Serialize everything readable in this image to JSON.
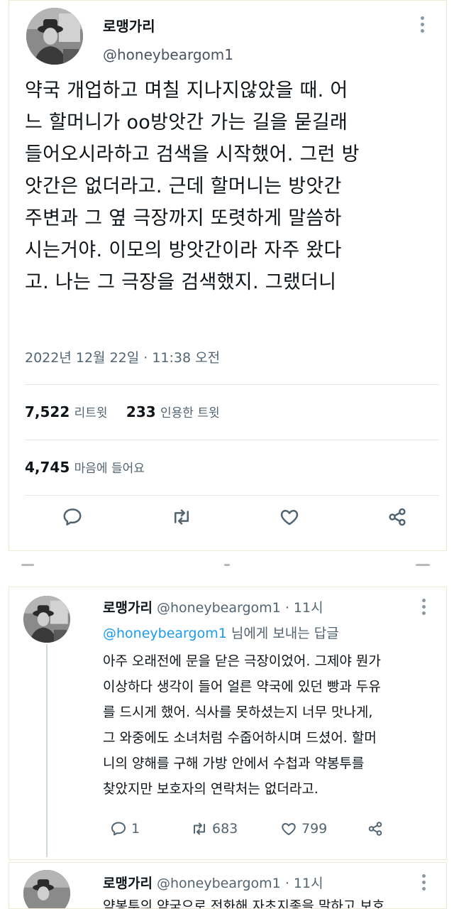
{
  "main_tweet": {
    "display_name": "로맹가리",
    "handle": "@honeybeargom1",
    "body_lines": [
      "약국 개업하고 며칠 지나지않았을 때. 어",
      "느 할머니가 oo방앗간 가는 길을 묻길래",
      "들어오시라하고 검색을 시작했어. 그런 방",
      "앗간은 없더라고. 근데 할머니는 방앗간",
      "주변과 그 옆 극장까지 또렷하게 말씀하",
      "시는거야. 이모의 방앗간이라 자주 왔다",
      "고. 나는 그 극장을 검색했지. 그랬더니"
    ],
    "timestamp": "2022년 12월 22일 · 11:38 오전",
    "retweets_count": "7,522",
    "retweets_label": "리트윗",
    "quotes_count": "233",
    "quotes_label": "인용한 트윗",
    "likes_count": "4,745",
    "likes_label": "마음에 들어요"
  },
  "reply_tweet": {
    "display_name": "로맹가리",
    "handle": "@honeybeargom1",
    "time": "· 11시",
    "reply_to_user": "@honeybeargom1",
    "reply_to_text": "님에게 보내는 답글",
    "body_lines": [
      "아주 오래전에 문을 닫은 극장이었어. 그제야 뭔가",
      "이상하다 생각이 들어 얼른 약국에 있던 빵과 두유",
      "를 드시게 했어. 식사를 못하셨는지 너무 맛나게,",
      "그 와중에도 소녀처럼 수줍어하시며 드셨어. 할머",
      "니의 양해를 구해 가방 안에서 수첩과 약봉투를",
      "찾았지만 보호자의 연락처는 없더라고."
    ],
    "reply_count": "1",
    "retweet_count": "683",
    "like_count": "799"
  },
  "third_tweet": {
    "display_name": "로맹가리",
    "handle": "@honeybeargom1",
    "time": "· 11시",
    "body_partial": "약봉투의 약국으로 전화해 자초지종을 말하고 보호"
  },
  "colors": {
    "text": "#0f1419",
    "secondary": "#536471",
    "link": "#1d9bf0",
    "border": "#e4e6e8"
  },
  "icons": [
    "more-icon",
    "reply-icon",
    "retweet-icon",
    "like-icon",
    "share-icon"
  ]
}
